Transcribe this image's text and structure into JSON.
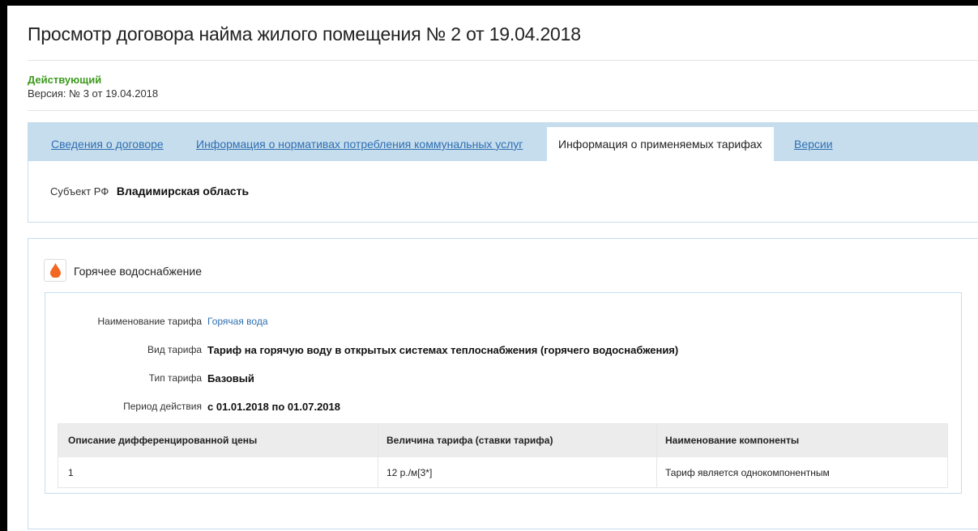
{
  "header": {
    "title": "Просмотр договора найма жилого помещения № 2 от 19.04.2018",
    "status": "Действующий",
    "version": "Версия: № 3 от 19.04.2018"
  },
  "tabs": [
    {
      "label": "Сведения о договоре",
      "active": false
    },
    {
      "label": "Информация о нормативах потребления коммунальных услуг",
      "active": false
    },
    {
      "label": "Информация о применяемых тарифах",
      "active": true
    },
    {
      "label": "Версии",
      "active": false
    }
  ],
  "subject": {
    "label": "Субъект РФ",
    "value": "Владимирская область"
  },
  "service": {
    "icon": "water-drop-icon",
    "icon_color": "#f26722",
    "name": "Горячее водоснабжение",
    "fields": {
      "tariff_name": {
        "label": "Наименование тарифа",
        "value": "Горячая вода"
      },
      "tariff_kind": {
        "label": "Вид тарифа",
        "value": "Тариф на горячую воду в открытых системах теплоснабжения (горячего водоснабжения)"
      },
      "tariff_type": {
        "label": "Тип тарифа",
        "value": "Базовый"
      },
      "period": {
        "label": "Период действия",
        "value": "с 01.01.2018 по 01.07.2018"
      }
    },
    "table": {
      "columns": [
        "Описание дифференцированной цены",
        "Величина тарифа (ставки тарифа)",
        "Наименование компоненты"
      ],
      "rows": [
        [
          "1",
          "12 р./м[3*]",
          "Тариф является однокомпонентным"
        ]
      ]
    }
  },
  "colors": {
    "accent": "#2f6fb0",
    "status_green": "#3d9a1e",
    "tab_bar": "#c6ddee",
    "table_header": "#ececec"
  }
}
